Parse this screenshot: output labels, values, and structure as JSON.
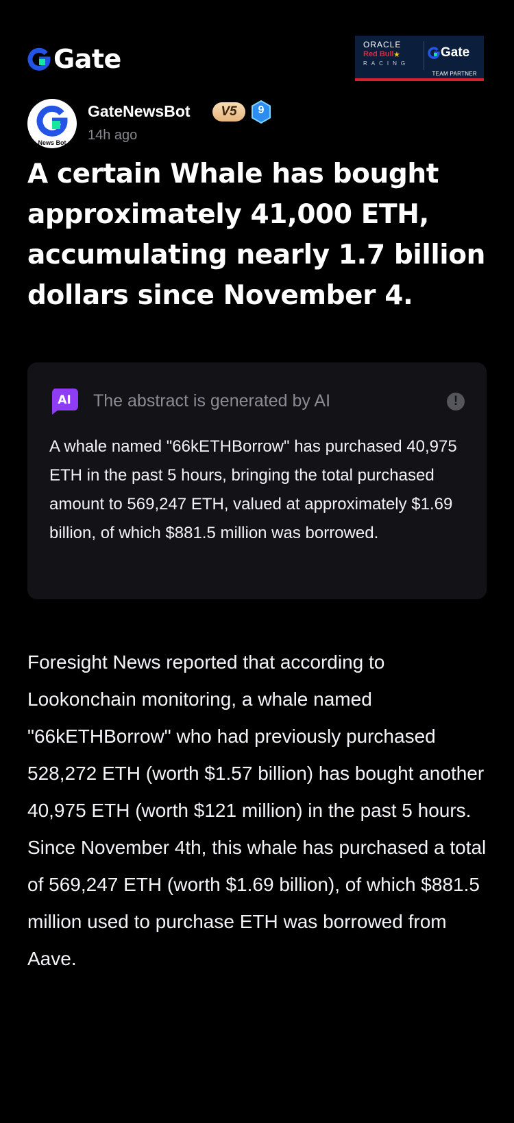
{
  "header": {
    "brand_name": "Gate",
    "partner": {
      "oracle": "ORACLE",
      "red_bull": "Red Bull",
      "racing": "RACING",
      "gate": "Gate",
      "team_partner": "TEAM PARTNER"
    }
  },
  "author": {
    "name": "GateNewsBot",
    "vip_badge": "V5",
    "level_badge": "9",
    "avatar_caption": "News Bot",
    "time_ago": "14h ago"
  },
  "article": {
    "headline": "A certain Whale has bought approximately 41,000 ETH, accumulating nearly 1.7 billion dollars since November 4.",
    "ai_summary": {
      "title": "The abstract is generated by AI",
      "icon_label": "AI",
      "body": "A whale named \"66kETHBorrow\" has purchased 40,975 ETH in the past 5 hours, bringing the total purchased amount to 569,247 ETH, valued at approximately $1.69 billion, of which $881.5 million was borrowed."
    },
    "body": "Foresight News reported that according to Lookonchain monitoring, a whale named \"66kETHBorrow\" who had previously purchased 528,272 ETH (worth $1.57 billion) has bought another 40,975 ETH (worth $121 million) in the past 5 hours. Since November 4th, this whale has purchased a total of 569,247 ETH (worth $1.69 billion), of which $881.5 million used to purchase ETH was borrowed from Aave."
  },
  "icons": {
    "brand": "gate-logo-icon",
    "info": "info-icon",
    "ai": "ai-icon",
    "level": "level-badge-icon"
  },
  "colors": {
    "background": "#000000",
    "brand_blue": "#2354E6",
    "brand_green": "#17E6A1",
    "card_background": "#121217",
    "muted_text": "#86878C",
    "ai_purple": "#8E3DF4"
  }
}
